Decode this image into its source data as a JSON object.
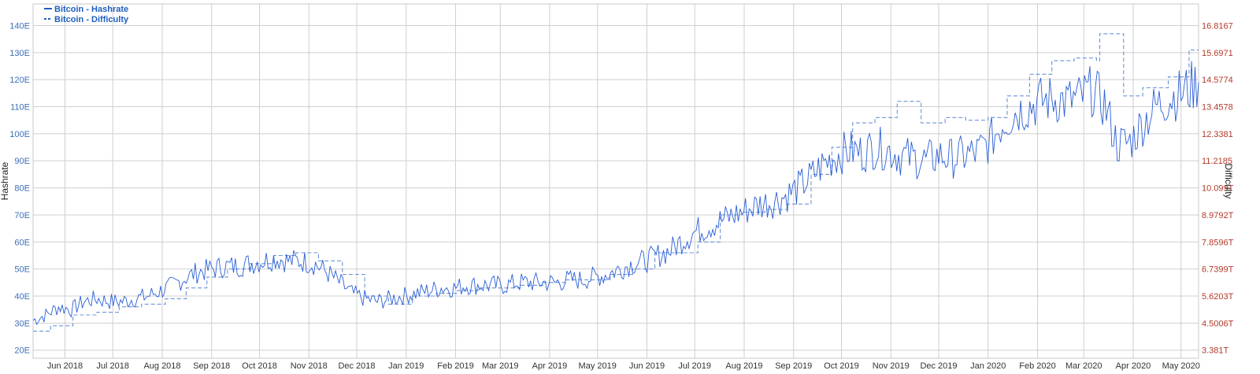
{
  "chart_data": {
    "type": "line",
    "title": "",
    "ylabel": "Hashrate",
    "ylabel_right": "Difficulty",
    "ylim": [
      17,
      148
    ],
    "y_ticks": [
      "20E",
      "30E",
      "40E",
      "50E",
      "60E",
      "70E",
      "80E",
      "90E",
      "100E",
      "110E",
      "120E",
      "130E",
      "140E"
    ],
    "y_tick_values": [
      20,
      30,
      40,
      50,
      60,
      70,
      80,
      90,
      100,
      110,
      120,
      130,
      140
    ],
    "y2_ticks": [
      "3.381T",
      "4.5006T",
      "5.6203T",
      "6.7399T",
      "7.8596T",
      "8.9792T",
      "10.099T",
      "11.2185",
      "12.3381",
      "13.4578",
      "14.5774",
      "15.6971",
      "16.8167"
    ],
    "x_tick_labels": [
      "Jun 2018",
      "Jul 2018",
      "Aug 2018",
      "Sep 2018",
      "Oct 2018",
      "Nov 2018",
      "Dec 2018",
      "Jan 2019",
      "Feb 2019",
      "Mar 2019",
      "Apr 2019",
      "May 2019",
      "Jun 2019",
      "Jul 2019",
      "Aug 2019",
      "Sep 2019",
      "Oct 2019",
      "Nov 2019",
      "Dec 2019",
      "Jan 2020",
      "Feb 2020",
      "Mar 2020",
      "Apr 2020",
      "May 2020"
    ],
    "x_range": [
      "2018-05-12",
      "2020-05-12"
    ],
    "grid": true,
    "legend_position": "top-left",
    "colors": {
      "hashrate": "#2a5fd6",
      "difficulty": "#6b93d6",
      "left_axis": "#3d6fb8",
      "right_axis": "#b23a2a",
      "grid": "#cfcfcf"
    },
    "series": [
      {
        "name": "Bitcoin - Hashrate",
        "style": "solid",
        "points": [
          [
            "2018-05-12",
            31
          ],
          [
            "2018-05-20",
            33
          ],
          [
            "2018-05-28",
            36
          ],
          [
            "2018-06-05",
            35
          ],
          [
            "2018-06-13",
            38
          ],
          [
            "2018-06-21",
            39
          ],
          [
            "2018-06-29",
            38
          ],
          [
            "2018-07-07",
            38
          ],
          [
            "2018-07-15",
            39
          ],
          [
            "2018-07-23",
            40
          ],
          [
            "2018-07-31",
            42
          ],
          [
            "2018-08-08",
            44
          ],
          [
            "2018-08-16",
            47
          ],
          [
            "2018-08-24",
            49
          ],
          [
            "2018-09-01",
            50
          ],
          [
            "2018-09-09",
            51
          ],
          [
            "2018-09-17",
            51
          ],
          [
            "2018-09-25",
            52
          ],
          [
            "2018-10-03",
            53
          ],
          [
            "2018-10-11",
            54
          ],
          [
            "2018-10-19",
            53
          ],
          [
            "2018-10-27",
            53
          ],
          [
            "2018-11-04",
            52
          ],
          [
            "2018-11-12",
            49
          ],
          [
            "2018-11-20",
            45
          ],
          [
            "2018-11-28",
            41
          ],
          [
            "2018-12-06",
            39
          ],
          [
            "2018-12-14",
            38
          ],
          [
            "2018-12-22",
            39
          ],
          [
            "2018-12-30",
            40
          ],
          [
            "2019-01-07",
            41
          ],
          [
            "2019-01-15",
            42
          ],
          [
            "2019-01-23",
            43
          ],
          [
            "2019-01-31",
            43
          ],
          [
            "2019-02-08",
            44
          ],
          [
            "2019-02-16",
            44
          ],
          [
            "2019-02-24",
            44
          ],
          [
            "2019-03-04",
            44
          ],
          [
            "2019-03-12",
            45
          ],
          [
            "2019-03-20",
            45
          ],
          [
            "2019-03-28",
            45
          ],
          [
            "2019-04-05",
            45
          ],
          [
            "2019-04-13",
            46
          ],
          [
            "2019-04-21",
            46
          ],
          [
            "2019-04-29",
            47
          ],
          [
            "2019-05-07",
            48
          ],
          [
            "2019-05-15",
            50
          ],
          [
            "2019-05-23",
            52
          ],
          [
            "2019-05-31",
            53
          ],
          [
            "2019-06-08",
            55
          ],
          [
            "2019-06-16",
            57
          ],
          [
            "2019-06-24",
            61
          ],
          [
            "2019-07-02",
            64
          ],
          [
            "2019-07-10",
            66
          ],
          [
            "2019-07-18",
            68
          ],
          [
            "2019-07-26",
            70
          ],
          [
            "2019-08-03",
            72
          ],
          [
            "2019-08-11",
            74
          ],
          [
            "2019-08-19",
            75
          ],
          [
            "2019-08-27",
            77
          ],
          [
            "2019-09-04",
            80
          ],
          [
            "2019-09-12",
            84
          ],
          [
            "2019-09-20",
            89
          ],
          [
            "2019-09-28",
            92
          ],
          [
            "2019-10-06",
            94
          ],
          [
            "2019-10-14",
            93
          ],
          [
            "2019-10-22",
            95
          ],
          [
            "2019-10-30",
            94
          ],
          [
            "2019-11-07",
            92
          ],
          [
            "2019-11-15",
            91
          ],
          [
            "2019-11-23",
            90
          ],
          [
            "2019-12-01",
            92
          ],
          [
            "2019-12-09",
            91
          ],
          [
            "2019-12-17",
            92
          ],
          [
            "2019-12-25",
            93
          ],
          [
            "2020-01-02",
            97
          ],
          [
            "2020-01-10",
            104
          ],
          [
            "2020-01-18",
            108
          ],
          [
            "2020-01-26",
            110
          ],
          [
            "2020-02-03",
            112
          ],
          [
            "2020-02-11",
            113
          ],
          [
            "2020-02-19",
            112
          ],
          [
            "2020-02-27",
            113
          ],
          [
            "2020-03-06",
            116
          ],
          [
            "2020-03-14",
            111
          ],
          [
            "2020-03-22",
            96
          ],
          [
            "2020-03-30",
            97
          ],
          [
            "2020-04-07",
            104
          ],
          [
            "2020-04-15",
            110
          ],
          [
            "2020-04-23",
            113
          ],
          [
            "2020-05-01",
            115
          ],
          [
            "2020-05-12",
            119
          ]
        ]
      },
      {
        "name": "Bitcoin - Difficulty",
        "style": "dashed",
        "steps": [
          [
            "2018-05-12",
            27
          ],
          [
            "2018-05-23",
            29
          ],
          [
            "2018-06-06",
            33
          ],
          [
            "2018-06-21",
            34
          ],
          [
            "2018-07-05",
            36
          ],
          [
            "2018-07-19",
            37
          ],
          [
            "2018-08-03",
            39
          ],
          [
            "2018-08-16",
            43
          ],
          [
            "2018-08-29",
            47
          ],
          [
            "2018-09-11",
            50
          ],
          [
            "2018-09-25",
            52
          ],
          [
            "2018-10-10",
            55
          ],
          [
            "2018-10-24",
            56
          ],
          [
            "2018-11-07",
            53
          ],
          [
            "2018-11-22",
            48
          ],
          [
            "2018-12-06",
            40
          ],
          [
            "2018-12-21",
            37
          ],
          [
            "2019-01-05",
            40
          ],
          [
            "2019-01-20",
            41
          ],
          [
            "2019-02-02",
            42
          ],
          [
            "2019-02-15",
            43
          ],
          [
            "2019-03-01",
            43
          ],
          [
            "2019-03-14",
            44
          ],
          [
            "2019-03-28",
            45
          ],
          [
            "2019-04-11",
            46
          ],
          [
            "2019-04-26",
            46
          ],
          [
            "2019-05-09",
            48
          ],
          [
            "2019-05-23",
            50
          ],
          [
            "2019-06-06",
            56
          ],
          [
            "2019-06-20",
            56
          ],
          [
            "2019-07-03",
            60
          ],
          [
            "2019-07-17",
            70
          ],
          [
            "2019-07-31",
            71
          ],
          [
            "2019-08-14",
            72
          ],
          [
            "2019-08-28",
            74
          ],
          [
            "2019-09-12",
            85
          ],
          [
            "2019-09-25",
            95
          ],
          [
            "2019-10-08",
            104
          ],
          [
            "2019-10-22",
            106
          ],
          [
            "2019-11-05",
            112
          ],
          [
            "2019-11-20",
            104
          ],
          [
            "2019-12-05",
            106
          ],
          [
            "2019-12-18",
            105
          ],
          [
            "2020-01-01",
            106
          ],
          [
            "2020-01-13",
            114
          ],
          [
            "2020-01-27",
            122
          ],
          [
            "2020-02-10",
            127
          ],
          [
            "2020-02-24",
            128
          ],
          [
            "2020-03-09",
            127
          ],
          [
            "2020-03-11",
            137
          ],
          [
            "2020-03-26",
            114
          ],
          [
            "2020-04-07",
            117
          ],
          [
            "2020-04-23",
            121
          ],
          [
            "2020-05-06",
            131
          ],
          [
            "2020-05-12",
            131
          ]
        ]
      }
    ]
  },
  "legend": [
    {
      "label": "Bitcoin - Hashrate",
      "style": "solid"
    },
    {
      "label": "Bitcoin - Difficulty",
      "style": "dashed"
    }
  ]
}
